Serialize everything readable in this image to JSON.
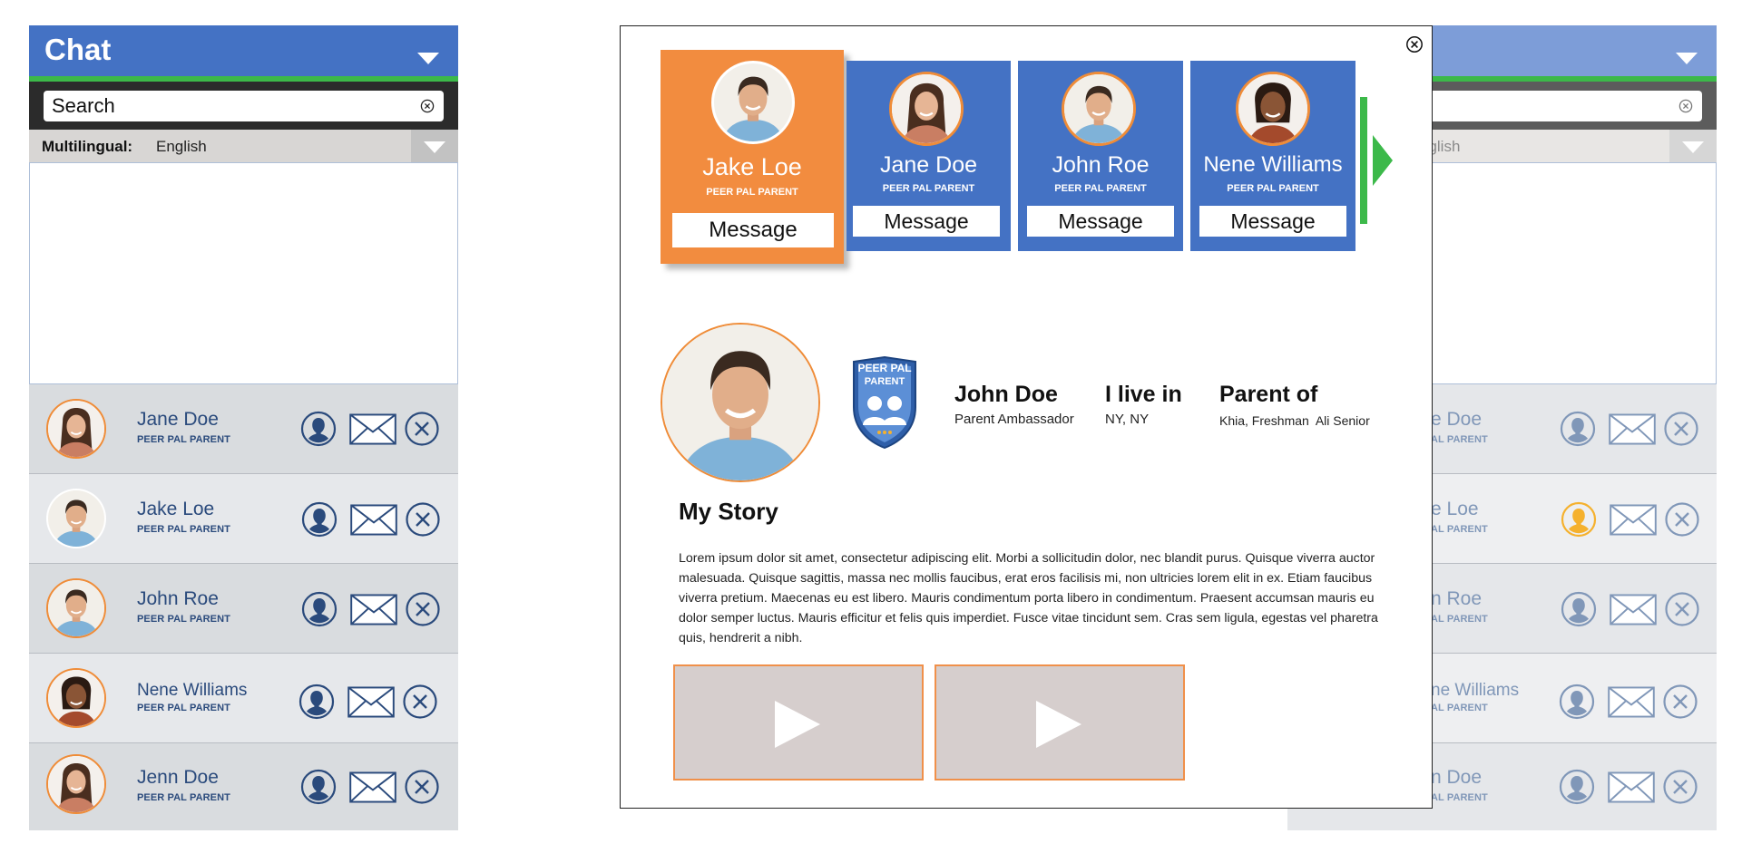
{
  "chat": {
    "title": "Chat",
    "search_placeholder": "Search",
    "multilingual_label": "Multilingual:",
    "language": "English",
    "contacts": [
      {
        "name": "Jane Doe",
        "role": "PEER PAL PARENT"
      },
      {
        "name": "Jake Loe",
        "role": "PEER PAL PARENT"
      },
      {
        "name": "John Roe",
        "role": "PEER PAL PARENT"
      },
      {
        "name": "Nene Williams",
        "role": "PEER PAL PARENT"
      },
      {
        "name": "Jenn Doe",
        "role": "PEER PAL PARENT"
      }
    ]
  },
  "right_chat": {
    "language_fragment": "nglish",
    "contacts": [
      {
        "name_fragment": "e Doe",
        "role_fragment": "AL PARENT"
      },
      {
        "name_fragment": "e Loe",
        "role_fragment": "AL PARENT"
      },
      {
        "name_fragment": "n Roe",
        "role_fragment": "AL PARENT"
      },
      {
        "name_fragment": "ne Williams",
        "role_fragment": "AL PARENT"
      },
      {
        "name_fragment": "n Doe",
        "role_fragment": "AL PARENT"
      }
    ]
  },
  "modal": {
    "cards": [
      {
        "name": "Jake Loe",
        "role": "PEER PAL PARENT",
        "button": "Message",
        "active": true
      },
      {
        "name": "Jane Doe",
        "role": "PEER PAL PARENT",
        "button": "Message",
        "active": false
      },
      {
        "name": "John Roe",
        "role": "PEER PAL PARENT",
        "button": "Message",
        "active": false
      },
      {
        "name": "Nene Williams",
        "role": "PEER PAL PARENT",
        "button": "Message",
        "active": false
      }
    ],
    "badge_text_1": "PEER PAL",
    "badge_text_2": "PARENT",
    "profile": {
      "name": "John Doe",
      "title": "Parent Ambassador",
      "live_heading": "I live in",
      "live_value": "NY, NY",
      "parent_heading": "Parent of",
      "parent_value": "Khia, Freshman  Ali Senior"
    },
    "story_heading": "My Story",
    "story_text": "Lorem ipsum dolor sit amet, consectetur adipiscing elit. Morbi a sollicitudin dolor, nec blandit purus. Quisque viverra auctor malesuada. Quisque sagittis, massa nec mollis faucibus, erat eros facilisis mi, non ultricies lorem elit in ex. Etiam faucibus viverra pretium. Maecenas eu est libero. Mauris condimentum porta libero in condimentum. Praesent accumsan mauris eu dolor semper luctus. Mauris efficitur et felis quis imperdiet. Fusce vitae tincidunt sem. Cras sem ligula, egestas vel pharetra quis, hendrerit a nibh."
  },
  "colors": {
    "brand_blue": "#4472c4",
    "accent_orange": "#f28c3f",
    "accent_green": "#3cb94a",
    "navy": "#2a4a7c"
  }
}
